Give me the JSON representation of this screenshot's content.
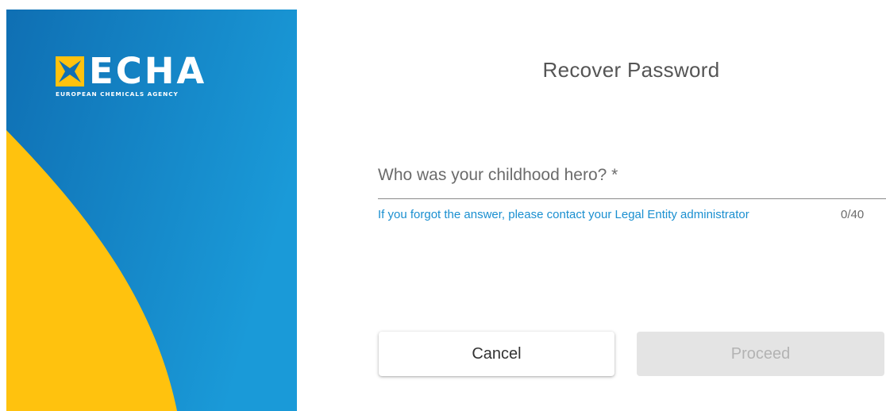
{
  "brand": {
    "name": "ECHA",
    "tagline": "EUROPEAN CHEMICALS AGENCY",
    "colors": {
      "blue_dark": "#0f6fb3",
      "blue_light": "#1a9ad8",
      "yellow": "#ffc20e"
    },
    "logo_icon": "echa-star-mark-icon"
  },
  "form": {
    "title": "Recover Password",
    "question_label": "Who was your childhood hero? *",
    "answer_value": "",
    "hint": "If you forgot the answer, please contact your Legal Entity administrator",
    "counter": "0/40",
    "cancel_label": "Cancel",
    "proceed_label": "Proceed",
    "proceed_disabled": true
  }
}
